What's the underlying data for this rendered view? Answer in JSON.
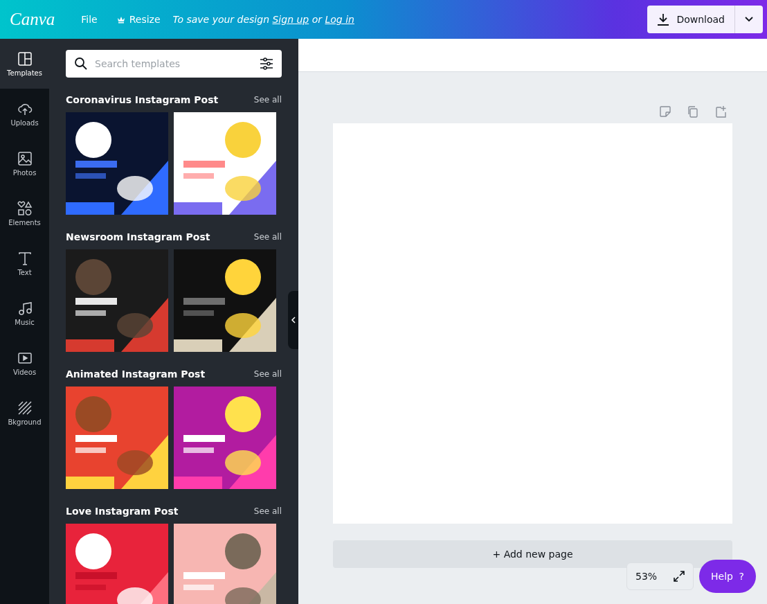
{
  "topbar": {
    "logo": "Canva",
    "menu": [
      {
        "kind": "plain",
        "label": "File"
      },
      {
        "kind": "crown",
        "label": "Resize"
      }
    ],
    "save_prompt": {
      "before": "To save your design",
      "signup_link": "Sign up",
      "between": "or",
      "login_link": "Log in"
    },
    "download": {
      "label": "Download"
    }
  },
  "rail": [
    {
      "kind": "templates",
      "label": "Templates",
      "selected": true
    },
    {
      "kind": "uploads",
      "label": "Uploads",
      "selected": false
    },
    {
      "kind": "photos",
      "label": "Photos",
      "selected": false
    },
    {
      "kind": "elements",
      "label": "Elements",
      "selected": false
    },
    {
      "kind": "text",
      "label": "Text",
      "selected": false
    },
    {
      "kind": "music",
      "label": "Music",
      "selected": false
    },
    {
      "kind": "videos",
      "label": "Videos",
      "selected": false
    },
    {
      "kind": "background",
      "label": "Bkground",
      "selected": false
    }
  ],
  "search": {
    "placeholder": "Search templates"
  },
  "sections": [
    {
      "title": "Coronavirus Instagram Post",
      "see_all": "See all"
    },
    {
      "title": "Newsroom Instagram Post",
      "see_all": "See all"
    },
    {
      "title": "Animated Instagram Post",
      "see_all": "See all"
    },
    {
      "title": "Love Instagram Post",
      "see_all": "See all"
    }
  ],
  "editor": {
    "add_page": "+ Add new page",
    "zoom": "53%",
    "help": {
      "label": "Help",
      "icon": "?"
    }
  }
}
